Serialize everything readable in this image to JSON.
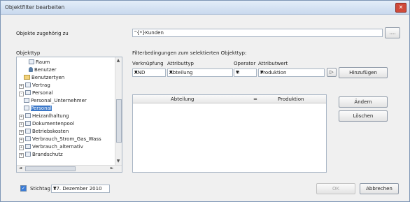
{
  "window": {
    "title": "Objektfilter bearbeiten",
    "close_glyph": "✕"
  },
  "assign": {
    "label": "Objekte zugehörig zu",
    "value": "\"{*}Kunden",
    "browse_label": "...."
  },
  "objects": {
    "label": "Objekttyp",
    "items": [
      {
        "label": "Raum",
        "icon": "table-icon",
        "expander": "",
        "indent": 2,
        "selected": false
      },
      {
        "label": "Benutzer",
        "icon": "user-icon",
        "expander": "",
        "indent": 2,
        "selected": false
      },
      {
        "label": "Benutzertyen",
        "icon": "folder-icon",
        "expander": "",
        "indent": 1,
        "selected": false
      },
      {
        "label": "Vertrag",
        "icon": "table-icon",
        "expander": "+",
        "indent": 0,
        "selected": false
      },
      {
        "label": "Personal",
        "icon": "table-icon",
        "expander": "-",
        "indent": 0,
        "selected": false
      },
      {
        "label": "Personal_Unternehmer",
        "icon": "table-icon",
        "expander": "",
        "indent": 1,
        "selected": false
      },
      {
        "label": "Personal",
        "icon": "table-icon",
        "expander": "",
        "indent": 1,
        "selected": true
      },
      {
        "label": "Heizanlhaltung",
        "icon": "table-icon",
        "expander": "+",
        "indent": 0,
        "selected": false
      },
      {
        "label": "Dokumentenpool",
        "icon": "table-icon",
        "expander": "+",
        "indent": 0,
        "selected": false
      },
      {
        "label": "Betriebskosten",
        "icon": "table-icon",
        "expander": "+",
        "indent": 0,
        "selected": false
      },
      {
        "label": "Verbrauch_Strom_Gas_Wass",
        "icon": "table-icon",
        "expander": "+",
        "indent": 0,
        "selected": false
      },
      {
        "label": "Verbrauch_alternativ",
        "icon": "table-icon",
        "expander": "+",
        "indent": 0,
        "selected": false
      },
      {
        "label": "Brandschutz",
        "icon": "table-icon",
        "expander": "+",
        "indent": 0,
        "selected": false
      }
    ],
    "scroll_up": "▲",
    "scroll_down": "▼",
    "scroll_left": "◄",
    "scroll_right": "►"
  },
  "filter": {
    "heading": "Filterbedingungen zum selektierten Objekttyp:",
    "col_link": "Verknüpfung",
    "col_attr": "Attributtyp",
    "col_op": "Operator",
    "col_val": "Attributwert",
    "link_value": "AND",
    "attr_value": "Abteilung",
    "op_value": "=",
    "val_value": "Produktion",
    "dropdown_glyph": "▼",
    "go_glyph": "▷",
    "add_label": "Hinzufügen",
    "change_label": "Ändern",
    "delete_label": "Löschen",
    "table_headers": {
      "attr": "Abteilung",
      "op": "=",
      "val": "Produktion"
    }
  },
  "footer": {
    "checkbox_checked": true,
    "check_glyph": "✓",
    "date_label": "Stichtag",
    "date_value": "17. Dezember 2010",
    "ok_label": "OK",
    "cancel_label": "Abbrechen"
  }
}
